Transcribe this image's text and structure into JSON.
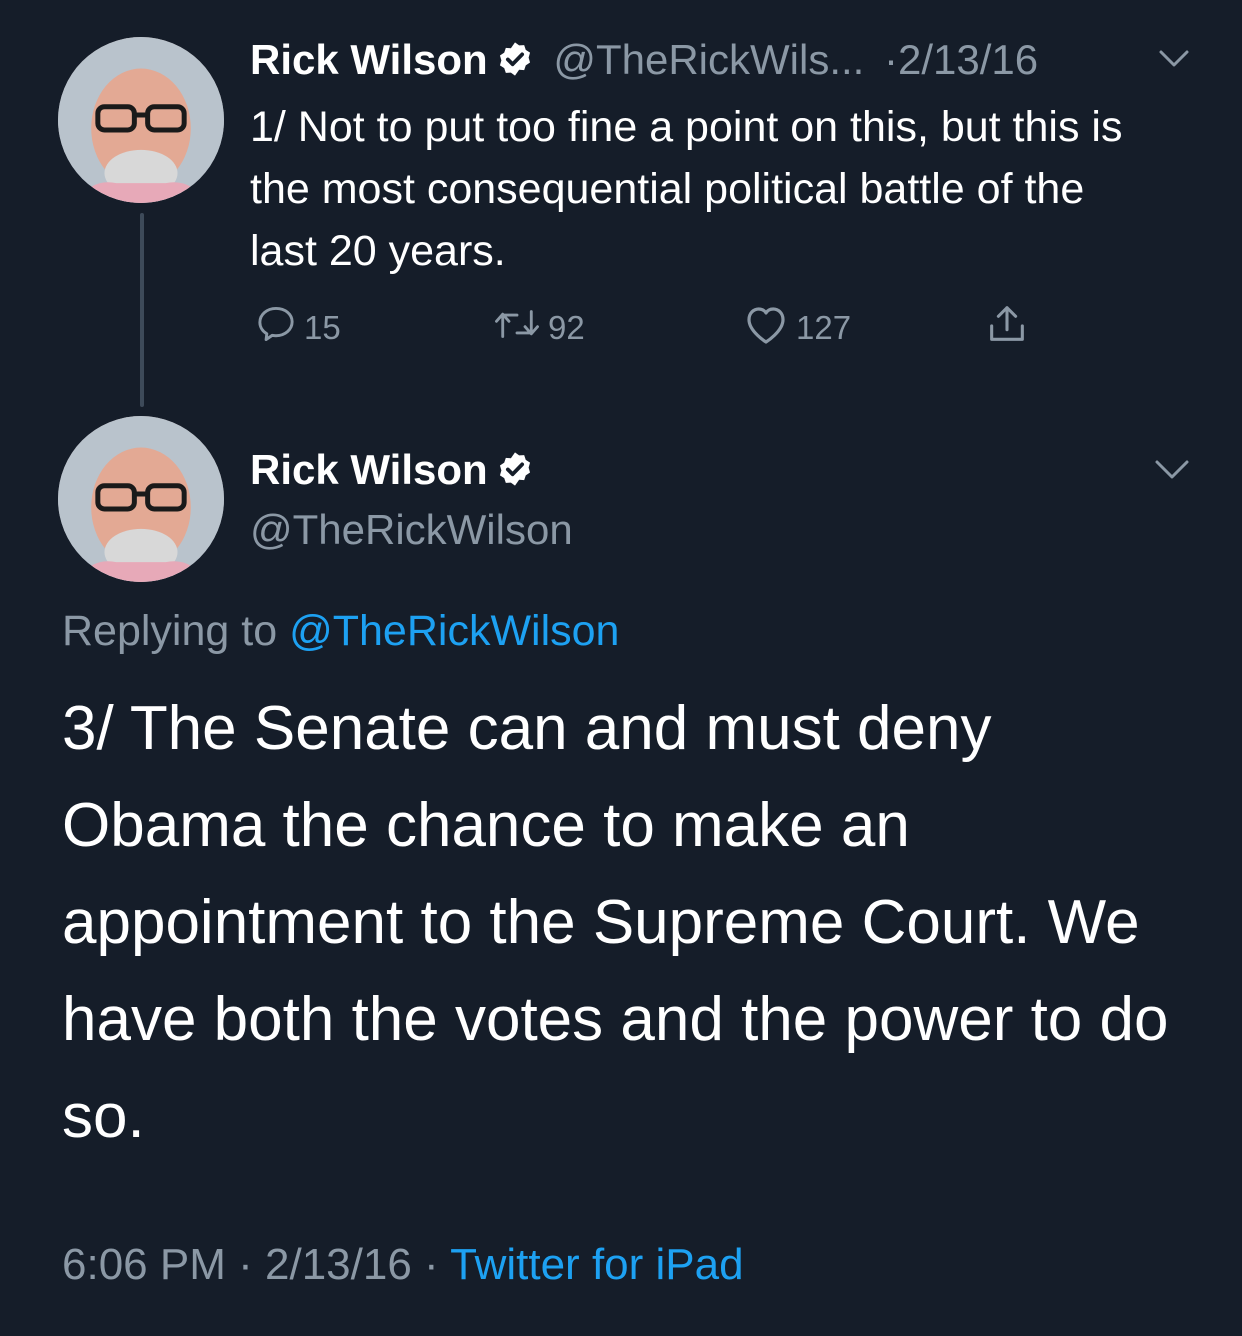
{
  "tweet1": {
    "name": "Rick Wilson",
    "handle": "@TheRickWils...",
    "date_sep": "·",
    "date": "2/13/16",
    "text": "1/ Not to put too fine a point on this, but this is the most consequential political battle of the last 20 years.",
    "replies": "15",
    "retweets": "92",
    "likes": "127"
  },
  "tweet2": {
    "name": "Rick Wilson",
    "handle": "@TheRickWilson",
    "replying_prefix": "Replying to",
    "replying_handle": "@TheRickWilson",
    "text": "3/ The Senate can and must deny Obama the chance to make an appointment to the Supreme Court. We have both the votes and the power to do so.",
    "time": "6:06 PM",
    "sep1": "·",
    "date": "2/13/16",
    "sep2": "·",
    "source": "Twitter for iPad"
  },
  "icons": {
    "verified": "verified-badge-icon",
    "reply": "reply-icon",
    "retweet": "retweet-icon",
    "like": "heart-icon",
    "share": "share-icon",
    "chevron": "chevron-down-icon"
  },
  "colors": {
    "background": "#151d29",
    "text": "#ffffff",
    "secondary": "#8b98a5",
    "link": "#1da1f2",
    "thread_line": "#3d4a59"
  }
}
